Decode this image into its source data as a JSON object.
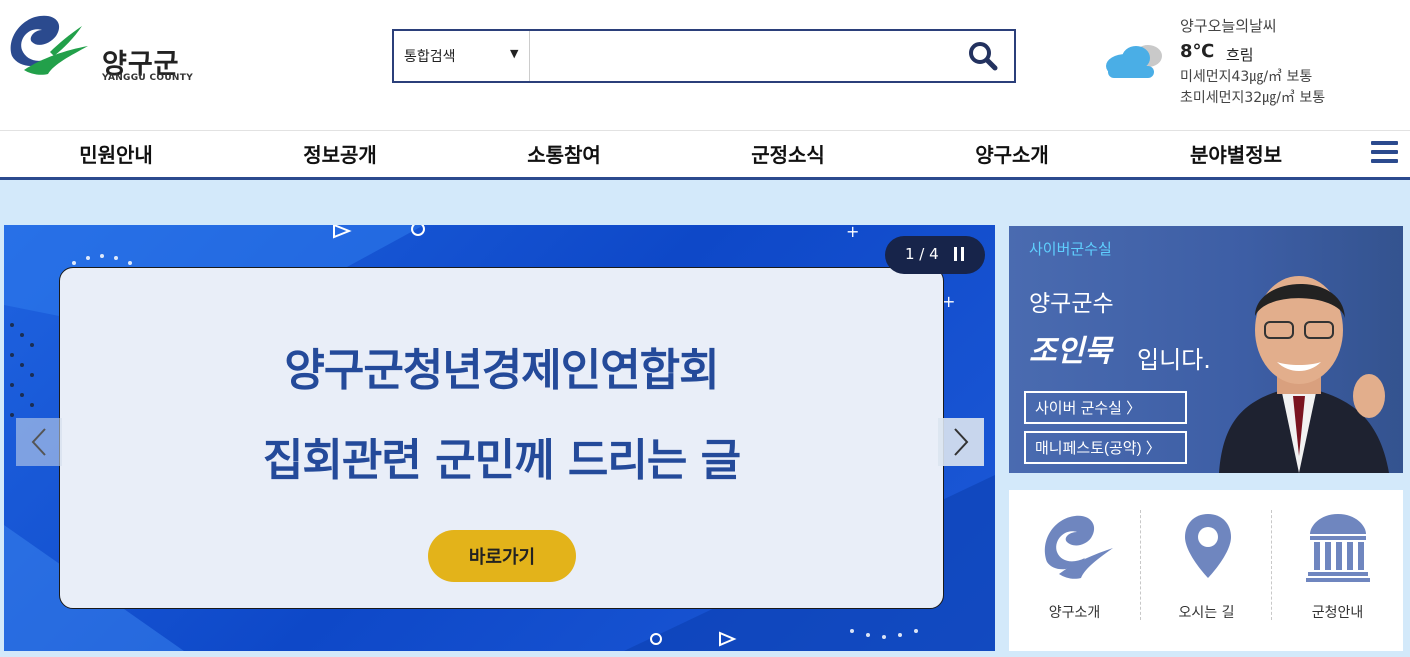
{
  "logo": {
    "name": "양구군",
    "sub": "YANGGU COUNTY"
  },
  "search": {
    "scope": "통합검색",
    "placeholder": ""
  },
  "weather": {
    "label": "양구오늘의날씨",
    "temp": "8℃",
    "condition": "흐림",
    "dust": "미세먼지43㎍/㎥ 보통",
    "fine_dust": "초미세먼지32㎍/㎥ 보통",
    "icon": "cloud-icon"
  },
  "nav": {
    "items": [
      {
        "label": "민원안내"
      },
      {
        "label": "정보공개"
      },
      {
        "label": "소통참여"
      },
      {
        "label": "군정소식"
      },
      {
        "label": "양구소개"
      },
      {
        "label": "분야별정보"
      }
    ]
  },
  "banner": {
    "counter": "1 / 4",
    "line1": "양구군청년경제인연합회",
    "line2": "집회관련 군민께 드리는 글",
    "cta": "바로가기"
  },
  "mayor": {
    "tag": "사이버군수실",
    "title": "양구군수",
    "name": "조인묵",
    "suffix": "입니다.",
    "btn1": "사이버 군수실 〉",
    "btn2": "매니페스토(공약) 〉"
  },
  "quick": [
    {
      "label": "양구소개",
      "icon": "county-logo-icon"
    },
    {
      "label": "오시는 길",
      "icon": "location-pin-icon"
    },
    {
      "label": "군청안내",
      "icon": "building-icon"
    }
  ],
  "colors": {
    "brand": "#2b4a8e",
    "accent": "#e3b31a",
    "banner": "#1f63e0"
  }
}
